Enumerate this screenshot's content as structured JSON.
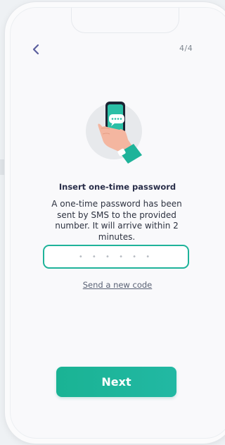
{
  "header": {
    "back_icon": "chevron-left-icon",
    "step": "4/4"
  },
  "illustration": {
    "icon": "phone-chat-bubble-icon"
  },
  "content": {
    "title": "Insert one-time password",
    "description": "A one-time password has been sent by SMS to the provided number. It will arrive within 2 minutes."
  },
  "otp": {
    "placeholder": "• • • • • •",
    "value": ""
  },
  "resend": {
    "label": "Send a new code"
  },
  "footer": {
    "next_label": "Next"
  },
  "colors": {
    "accent": "#1fb39a",
    "title": "#2a2f4a",
    "back_icon": "#5b5f9e"
  }
}
